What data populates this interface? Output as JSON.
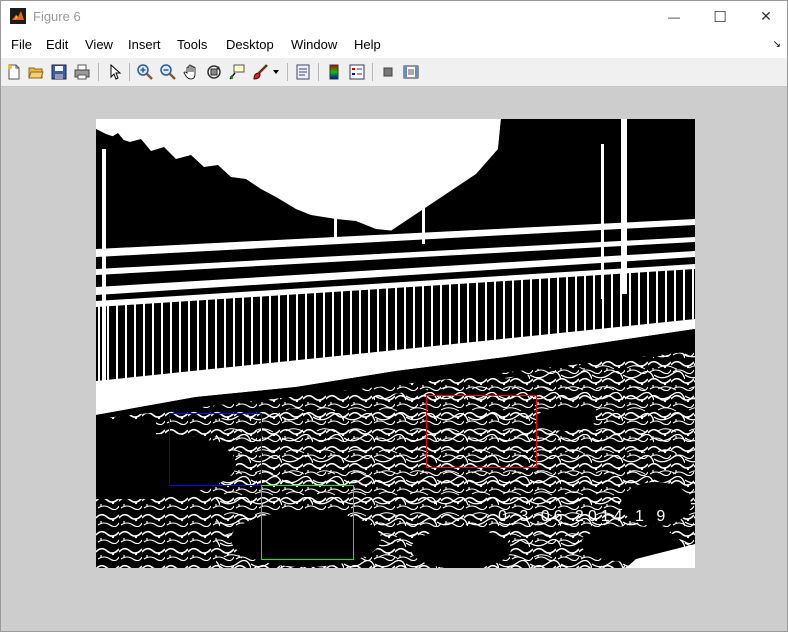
{
  "window": {
    "title": "Figure 6",
    "controls": {
      "minimize": "—",
      "maximize": "☐",
      "close": "✕"
    }
  },
  "menubar": {
    "items": [
      "File",
      "Edit",
      "View",
      "Insert",
      "Tools",
      "Desktop",
      "Window",
      "Help"
    ],
    "dock_arrow": "↘"
  },
  "toolbar": {
    "icons": [
      "new-figure-icon",
      "open-file-icon",
      "save-icon",
      "print-icon",
      "pointer-icon",
      "zoom-in-icon",
      "zoom-out-icon",
      "pan-hand-icon",
      "rotate-3d-icon",
      "data-cursor-icon",
      "brush-icon",
      "link-plot-icon",
      "colorbar-icon",
      "legend-icon",
      "hide-plot-tools-icon",
      "show-plot-tools-icon"
    ]
  },
  "image": {
    "description_type": "binary-thresholded-photo",
    "overlay_text": "0 3  06  2014  1  9",
    "roi_boxes": [
      {
        "name": "blue-roi",
        "color": "#0000ff"
      },
      {
        "name": "green-roi",
        "color": "#00ff00"
      },
      {
        "name": "red-roi",
        "color": "#ff0000"
      }
    ]
  },
  "colors": {
    "canvas_bg": "#cdcdcd",
    "matlab_orange": "#e06a1b"
  }
}
